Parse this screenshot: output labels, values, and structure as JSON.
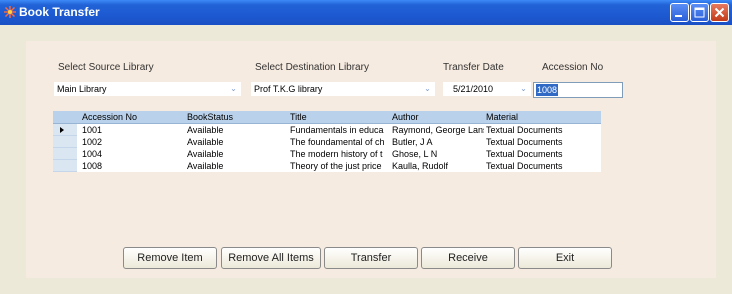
{
  "window": {
    "title": "Book Transfer"
  },
  "form": {
    "source_label": "Select Source  Library",
    "dest_label": "Select Destination  Library",
    "date_label": "Transfer Date",
    "accession_label": "Accession No",
    "source_value": "Main Library",
    "dest_value": "Prof T.K.G library",
    "date_value": "5/21/2010",
    "accession_value": "1008"
  },
  "grid": {
    "columns": [
      "Accession No",
      "BookStatus",
      "Title",
      "Author",
      "Material"
    ],
    "rows": [
      [
        "1001",
        "Available",
        "Fundamentals in educa",
        "Raymond, George Lans",
        "Textual Documents"
      ],
      [
        "1002",
        "Available",
        "The foundamental of ch",
        "Butler, J A",
        "Textual Documents"
      ],
      [
        "1004",
        "Available",
        "The modern history of t",
        "Ghose, L N",
        "Textual Documents"
      ],
      [
        "1008",
        "Available",
        "Theory of the just price",
        "Kaulla, Rudolf",
        "Textual Documents"
      ]
    ]
  },
  "buttons": {
    "remove_item": "Remove Item",
    "remove_all": "Remove All Items",
    "transfer": "Transfer",
    "receive": "Receive",
    "exit": "Exit"
  },
  "icons": {
    "app": "app-icon",
    "minimize": "minimize-icon",
    "maximize": "maximize-icon",
    "close": "close-icon",
    "dropdown": "chevron-down-icon",
    "row_pointer": "row-pointer-icon"
  },
  "colors": {
    "titlebar": "#1d5ad2",
    "panel": "#f6ebe0",
    "grid_header": "#b9d1ea",
    "selection": "#316ac5"
  }
}
